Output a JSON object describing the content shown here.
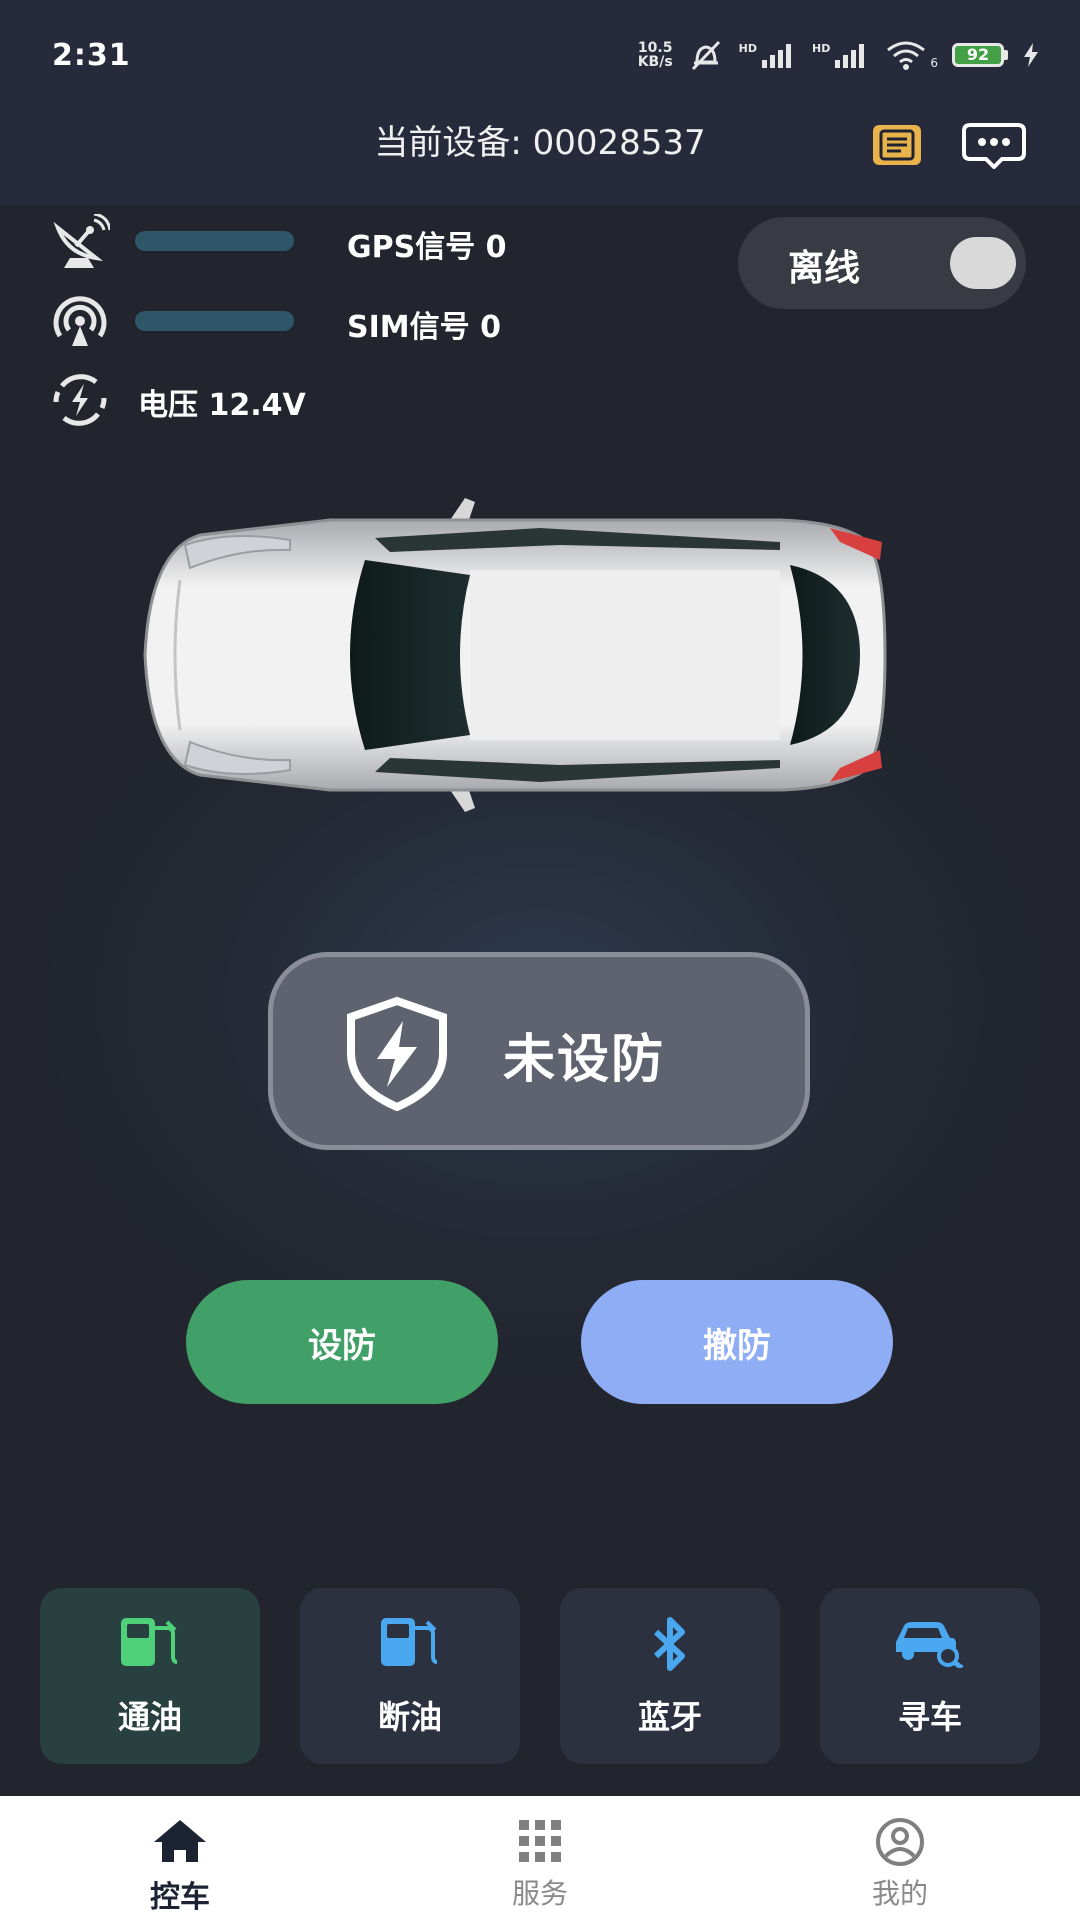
{
  "status_bar": {
    "time": "2:31",
    "net_speed": "10.5",
    "net_unit": "KB/s",
    "hd1": "HD",
    "hd2": "HD",
    "wifi_sub": "6",
    "battery": "92"
  },
  "header": {
    "title": "当前设备: 00028537"
  },
  "signals": {
    "gps": {
      "label": "GPS信号 0",
      "level": 0
    },
    "sim": {
      "label": "SIM信号 0",
      "level": 0
    },
    "voltage": {
      "label": "电压 12.4V"
    }
  },
  "online_toggle": {
    "label": "离线",
    "on": false
  },
  "arm_status": {
    "text": "未设防"
  },
  "buttons": {
    "arm": "设防",
    "disarm": "撤防"
  },
  "quick_actions": [
    {
      "label": "通油",
      "icon": "fuel-pump-icon",
      "color": "#4fd17a"
    },
    {
      "label": "断油",
      "icon": "fuel-pump-icon",
      "color": "#4aa8f0"
    },
    {
      "label": "蓝牙",
      "icon": "bluetooth-icon",
      "color": "#4aa8f0"
    },
    {
      "label": "寻车",
      "icon": "find-car-icon",
      "color": "#4aa8f0"
    }
  ],
  "bottom_nav": [
    {
      "label": "控车",
      "icon": "home-icon",
      "active": true
    },
    {
      "label": "服务",
      "icon": "grid-icon",
      "active": false
    },
    {
      "label": "我的",
      "icon": "profile-icon",
      "active": false
    }
  ],
  "colors": {
    "header_bg": "#272a3a",
    "page_bg": "#22252d",
    "arm_green": "#41a067",
    "disarm_blue": "#8fadf5"
  }
}
